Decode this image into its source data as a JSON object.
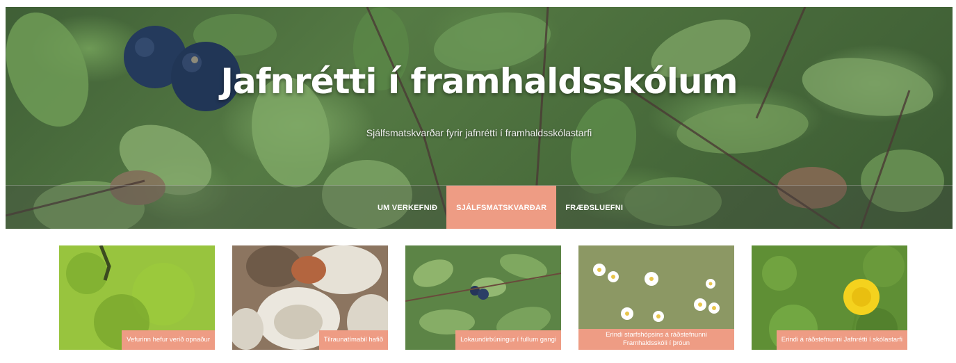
{
  "header": {
    "title": "Jafnrétti í framhaldsskólum",
    "subtitle": "Sjálfsmatskvarðar fyrir jafnrétti í framhaldsskólastarfi"
  },
  "nav": {
    "items": [
      {
        "label": "UM VERKEFNIÐ",
        "active": false
      },
      {
        "label": "SJÁLFSMATSKVARÐAR",
        "active": true
      },
      {
        "label": "FRÆÐSLUEFNI",
        "active": false
      }
    ]
  },
  "cards": [
    {
      "caption": "Vefurinn hefur verið opnaður"
    },
    {
      "caption": "Tilraunatímabil hafið"
    },
    {
      "caption": "Lokaundirbúningur í fullum gangi"
    },
    {
      "caption": "Erindi starfshópsins á ráðstefnunni Framhaldsskóli í þróun"
    },
    {
      "caption": "Erindi á ráðstefnunni Jafnrétti í skólastarfi"
    }
  ],
  "colors": {
    "accent": "#ee9c84",
    "text_light": "#ffffff"
  }
}
